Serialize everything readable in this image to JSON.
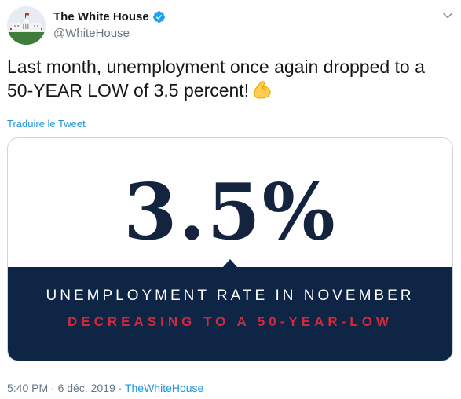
{
  "tweet": {
    "display_name": "The White House",
    "handle": "@WhiteHouse",
    "verified_icon": "verified-badge-icon",
    "text": "Last month, unemployment once again dropped to a 50-YEAR LOW of 3.5 percent!",
    "emoji": "flexed-biceps-emoji",
    "translate_label": "Traduire le Tweet",
    "time": "5:40 PM",
    "date": "6 déc. 2019",
    "separator": "·",
    "source": "TheWhiteHouse"
  },
  "card": {
    "big_number": "3.5%",
    "line1": "UNEMPLOYMENT RATE IN NOVEMBER",
    "line2": "DECREASING TO A 50-YEAR-LOW"
  },
  "colors": {
    "accent": "#1b95e0",
    "navy": "#0f2546",
    "red": "#d6283b",
    "text": "#14171a",
    "muted": "#657786"
  }
}
